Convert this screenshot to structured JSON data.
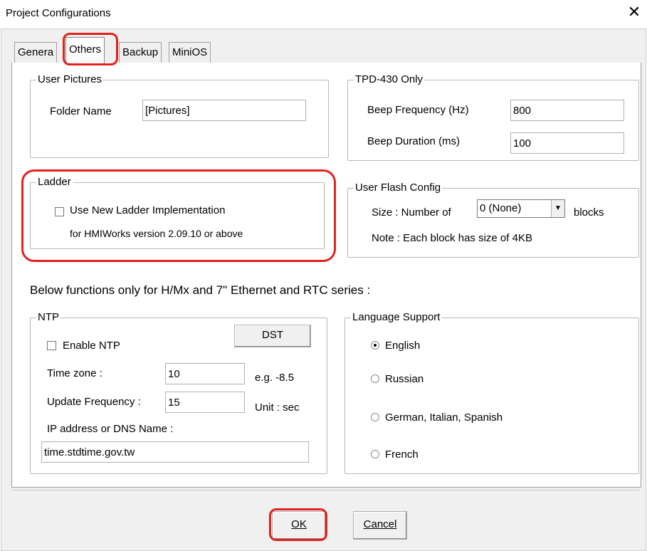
{
  "window": {
    "title": "Project Configurations",
    "close_glyph": "✕"
  },
  "tabs": [
    {
      "label": "Genera"
    },
    {
      "label": "Others"
    },
    {
      "label": "Backup"
    },
    {
      "label": "MiniOS"
    }
  ],
  "user_pictures": {
    "legend": "User Pictures",
    "folder_label": "Folder Name",
    "folder_value": "[Pictures]"
  },
  "tpd": {
    "legend": "TPD-430 Only",
    "beep_freq_label": "Beep Frequency (Hz)",
    "beep_freq_value": "800",
    "beep_dur_label": "Beep Duration (ms)",
    "beep_dur_value": "100"
  },
  "ladder": {
    "legend": "Ladder",
    "checkbox_label": "Use New Ladder Implementation",
    "note": "for HMIWorks version 2.09.10 or above",
    "checked": false
  },
  "flash": {
    "legend": "User Flash Config",
    "size_label": "Size :  Number of",
    "size_value": "0 (None)",
    "blocks_label": "blocks",
    "note": "Note : Each block has size of 4KB"
  },
  "section_heading": "Below functions only for H/Mx and 7\" Ethernet and RTC series :",
  "ntp": {
    "legend": "NTP",
    "enable_label": "Enable NTP",
    "enabled": false,
    "dst_label": "DST",
    "timezone_label": "Time zone :",
    "timezone_value": "10",
    "timezone_hint": "e.g. -8.5",
    "update_label": "Update Frequency :",
    "update_value": "15",
    "update_hint": "Unit : sec",
    "ip_label": "IP address or DNS Name :",
    "ip_value": "time.stdtime.gov.tw"
  },
  "language": {
    "legend": "Language Support",
    "options": [
      {
        "label": "English",
        "selected": true
      },
      {
        "label": "Russian",
        "selected": false
      },
      {
        "label": "German, Italian, Spanish",
        "selected": false
      },
      {
        "label": "French",
        "selected": false
      }
    ]
  },
  "buttons": {
    "ok": "OK",
    "cancel": "Cancel"
  },
  "colors": {
    "highlight": "#e1221f",
    "pane_bg": "#ffffff",
    "dialog_bg": "#f0f0f0"
  },
  "icons": {
    "close": "close-icon",
    "dropdown": "chevron-down-icon"
  }
}
